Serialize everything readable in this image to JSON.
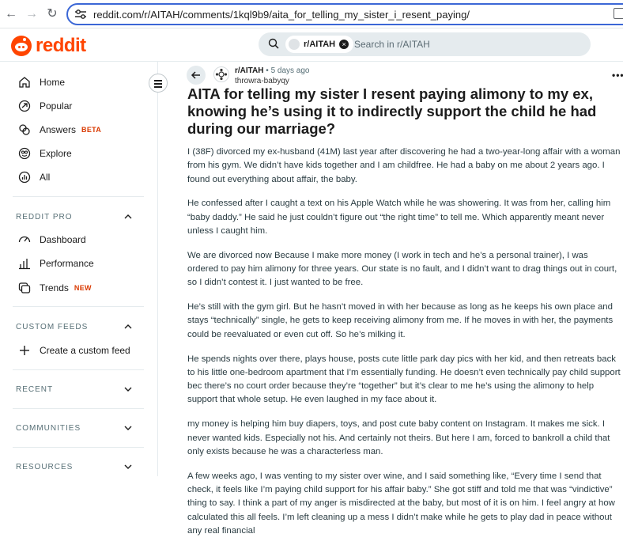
{
  "browser": {
    "url": "reddit.com/r/AITAH/comments/1kql9b9/aita_for_telling_my_sister_i_resent_paying/"
  },
  "header": {
    "logo_text": "reddit",
    "search_chip": "r/AITAH",
    "search_placeholder": "Search in r/AITAH"
  },
  "sidebar": {
    "main_items": [
      {
        "label": "Home",
        "icon": "home-icon"
      },
      {
        "label": "Popular",
        "icon": "popular-icon"
      },
      {
        "label": "Answers",
        "icon": "answers-icon",
        "badge": "BETA"
      },
      {
        "label": "Explore",
        "icon": "explore-icon"
      },
      {
        "label": "All",
        "icon": "all-icon"
      }
    ],
    "reddit_pro": {
      "heading": "REDDIT PRO",
      "items": [
        {
          "label": "Dashboard",
          "icon": "dashboard-icon"
        },
        {
          "label": "Performance",
          "icon": "performance-icon"
        },
        {
          "label": "Trends",
          "icon": "trends-icon",
          "badge": "NEW"
        }
      ]
    },
    "custom_feeds": {
      "heading": "CUSTOM FEEDS",
      "create_label": "Create a custom feed"
    },
    "recent": {
      "heading": "RECENT"
    },
    "communities": {
      "heading": "COMMUNITIES"
    },
    "resources": {
      "heading": "RESOURCES"
    }
  },
  "post": {
    "subreddit": "r/AITAH",
    "separator": "•",
    "time": "5 days ago",
    "author": "throwra-babyqy",
    "title": "AITA for telling my sister I resent paying alimony to my ex, knowing he’s using it to indirectly support the child he had during our marriage?",
    "paragraphs": [
      "I (38F) divorced my ex-husband (41M) last year after discovering he had a two-year-long affair with a woman from his gym. We didn’t have kids together and I am childfree. He had a baby on me about 2 years ago. I found out everything about affair, the baby.",
      "He confessed after I caught a text on his Apple Watch while he was showering. It was from her, calling him “baby daddy.” He said he just couldn’t figure out “the right time” to tell me. Which apparently meant never unless I caught him.",
      "We are divorced now Because I make more money (I work in tech and he’s a personal trainer), I was ordered to pay him alimony for three years. Our state is no fault, and I didn’t want to drag things out in court, so I didn’t contest it. I just wanted to be free.",
      "He’s still with the gym girl. But he hasn’t moved in with her because as long as he keeps his own place and stays “technically” single, he gets to keep receiving alimony from me. If he moves in with her, the payments could be reevaluated or even cut off. So he’s milking it.",
      "He spends nights over there, plays house, posts cute little park day pics with her kid, and then retreats back to his little one-bedroom apartment that I’m essentially funding. He doesn’t even technically pay child support bec there’s no court order because they’re “together” but it’s clear to me he’s using the alimony to help support that whole setup. He even laughed in my face about it.",
      "my money is helping him buy diapers, toys, and post cute baby content on Instagram. It makes me sick. I never wanted kids. Especially not his. And certainly not theirs. But here I am, forced to bankroll a child that only exists because he was a characterless man.",
      "A few weeks ago, I was venting to my sister over wine, and I said something like, “Every time I send that check, it feels like I’m paying child support for his affair baby.” She got stiff and told me that was “vindictive” thing to say. I think a part of my anger is misdirected at the baby, but most of it is on him. I feel angry at how calculated this all feels. I’m left cleaning up a mess I didn’t make while he gets to play dad in peace without any real financial"
    ]
  },
  "colors": {
    "brand": "#ff4500",
    "badge": "#d93900",
    "url_outline": "#3b67d6"
  }
}
